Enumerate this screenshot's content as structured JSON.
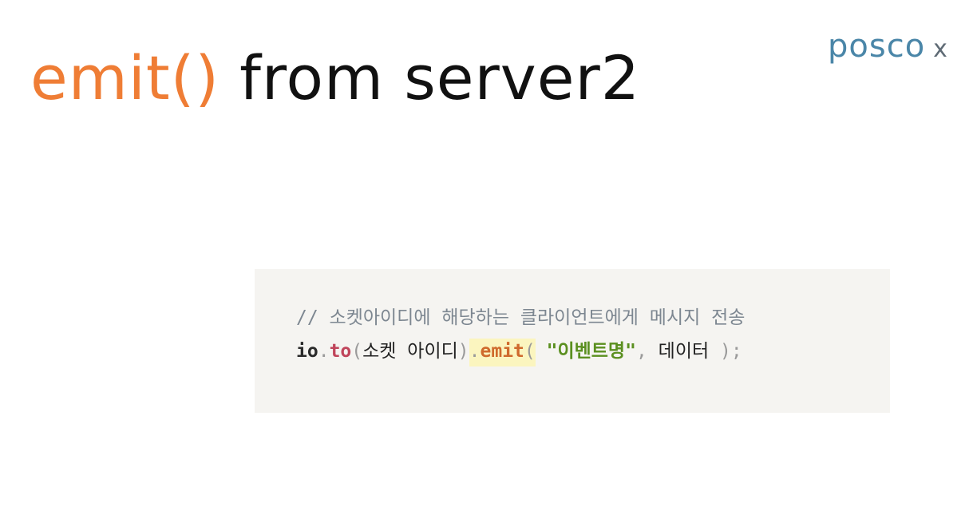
{
  "slide": {
    "title": {
      "accent": "emit()",
      "rest": " from server2"
    },
    "logo": {
      "text": "posco",
      "suffix": "x"
    }
  },
  "code": {
    "comment": "// 소켓아이디에 해당하는 클라이언트에게 메시지 전송",
    "line2": {
      "obj": "io",
      "dot1": ".",
      "method1": "to",
      "paren_open": "(",
      "arg": "소켓 아이디",
      "paren_close": ")",
      "dot2": ".",
      "method2": "emit",
      "paren_open2": "(",
      "space": " ",
      "event_string": "\"이벤트명\"",
      "comma": ",",
      "data_arg": " 데이터 ",
      "end": ");"
    }
  },
  "colors": {
    "accent": "#ef7d35",
    "logo": "#4a86a8",
    "code_background": "#f5f4f1",
    "highlight": "#fbf5bf",
    "string": "#5a8f1f",
    "method": "#c0455b"
  }
}
